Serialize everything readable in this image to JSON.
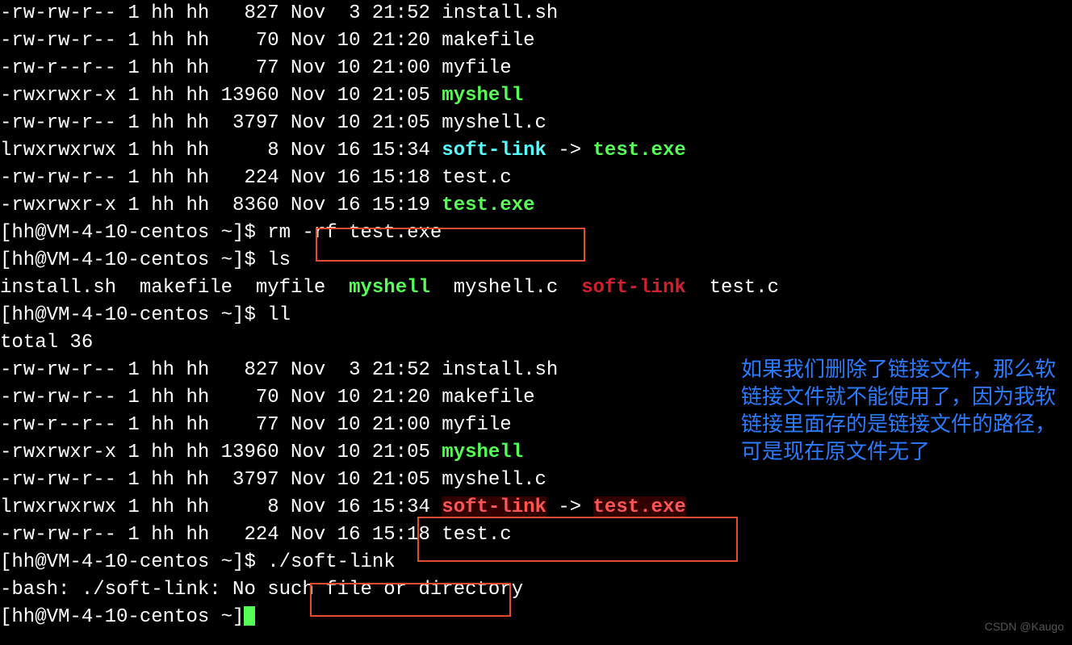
{
  "prompt": "[hh@VM-4-10-centos ~]$ ",
  "ls1": [
    {
      "perm": "-rw-rw-r--",
      "links": "1",
      "owner": "hh",
      "group": "hh",
      "size": "827",
      "month": "Nov",
      "day": "3",
      "time": "21:52",
      "name": "install.sh",
      "type": "file"
    },
    {
      "perm": "-rw-rw-r--",
      "links": "1",
      "owner": "hh",
      "group": "hh",
      "size": "70",
      "month": "Nov",
      "day": "10",
      "time": "21:20",
      "name": "makefile",
      "type": "file"
    },
    {
      "perm": "-rw-r--r--",
      "links": "1",
      "owner": "hh",
      "group": "hh",
      "size": "77",
      "month": "Nov",
      "day": "10",
      "time": "21:00",
      "name": "myfile",
      "type": "file"
    },
    {
      "perm": "-rwxrwxr-x",
      "links": "1",
      "owner": "hh",
      "group": "hh",
      "size": "13960",
      "month": "Nov",
      "day": "10",
      "time": "21:05",
      "name": "myshell",
      "type": "exec"
    },
    {
      "perm": "-rw-rw-r--",
      "links": "1",
      "owner": "hh",
      "group": "hh",
      "size": "3797",
      "month": "Nov",
      "day": "10",
      "time": "21:05",
      "name": "myshell.c",
      "type": "file"
    },
    {
      "perm": "lrwxrwxrwx",
      "links": "1",
      "owner": "hh",
      "group": "hh",
      "size": "8",
      "month": "Nov",
      "day": "16",
      "time": "15:34",
      "name": "soft-link",
      "type": "link",
      "target": "test.exe",
      "target_type": "exec"
    },
    {
      "perm": "-rw-rw-r--",
      "links": "1",
      "owner": "hh",
      "group": "hh",
      "size": "224",
      "month": "Nov",
      "day": "16",
      "time": "15:18",
      "name": "test.c",
      "type": "file"
    },
    {
      "perm": "-rwxrwxr-x",
      "links": "1",
      "owner": "hh",
      "group": "hh",
      "size": "8360",
      "month": "Nov",
      "day": "16",
      "time": "15:19",
      "name": "test.exe",
      "type": "exec"
    }
  ],
  "cmd1": "rm -rf test.exe",
  "cmd2": "ls",
  "ls_short": [
    {
      "name": "install.sh",
      "type": "file"
    },
    {
      "name": "makefile",
      "type": "file"
    },
    {
      "name": "myfile",
      "type": "file"
    },
    {
      "name": "myshell",
      "type": "exec"
    },
    {
      "name": "myshell.c",
      "type": "file"
    },
    {
      "name": "soft-link",
      "type": "broken"
    },
    {
      "name": "test.c",
      "type": "file"
    }
  ],
  "cmd3": "ll",
  "total": "total 36",
  "ls2": [
    {
      "perm": "-rw-rw-r--",
      "links": "1",
      "owner": "hh",
      "group": "hh",
      "size": "827",
      "month": "Nov",
      "day": "3",
      "time": "21:52",
      "name": "install.sh",
      "type": "file"
    },
    {
      "perm": "-rw-rw-r--",
      "links": "1",
      "owner": "hh",
      "group": "hh",
      "size": "70",
      "month": "Nov",
      "day": "10",
      "time": "21:20",
      "name": "makefile",
      "type": "file"
    },
    {
      "perm": "-rw-r--r--",
      "links": "1",
      "owner": "hh",
      "group": "hh",
      "size": "77",
      "month": "Nov",
      "day": "10",
      "time": "21:00",
      "name": "myfile",
      "type": "file"
    },
    {
      "perm": "-rwxrwxr-x",
      "links": "1",
      "owner": "hh",
      "group": "hh",
      "size": "13960",
      "month": "Nov",
      "day": "10",
      "time": "21:05",
      "name": "myshell",
      "type": "exec"
    },
    {
      "perm": "-rw-rw-r--",
      "links": "1",
      "owner": "hh",
      "group": "hh",
      "size": "3797",
      "month": "Nov",
      "day": "10",
      "time": "21:05",
      "name": "myshell.c",
      "type": "file"
    },
    {
      "perm": "lrwxrwxrwx",
      "links": "1",
      "owner": "hh",
      "group": "hh",
      "size": "8",
      "month": "Nov",
      "day": "16",
      "time": "15:34",
      "name": "soft-link",
      "type": "redbg",
      "target": "test.exe",
      "target_type": "redbg"
    },
    {
      "perm": "-rw-rw-r--",
      "links": "1",
      "owner": "hh",
      "group": "hh",
      "size": "224",
      "month": "Nov",
      "day": "16",
      "time": "15:18",
      "name": "test.c",
      "type": "file"
    }
  ],
  "cmd4": "./soft-link",
  "error": "-bash: ./soft-link: No such file or directory",
  "annotation": "如果我们删除了链接文件，那么软链接文件就不能使用了，因为我软链接里面存的是链接文件的路径，可是现在原文件无了",
  "watermark": "CSDN @Kaugo"
}
